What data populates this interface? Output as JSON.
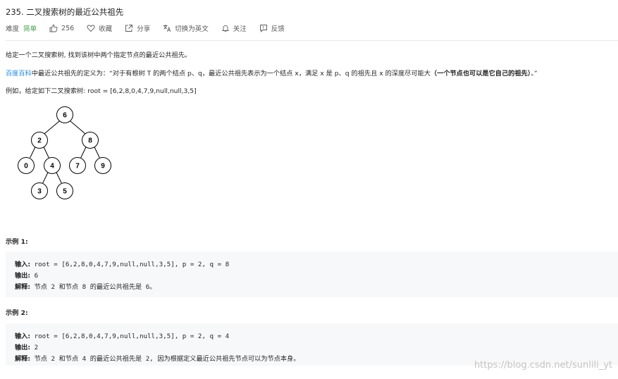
{
  "problem": {
    "title": "235. 二叉搜索树的最近公共祖先",
    "difficulty_label": "难度",
    "difficulty": "简单",
    "likes": "256",
    "actions": {
      "favorite": "收藏",
      "share": "分享",
      "switch_lang": "切换为英文",
      "follow": "关注",
      "feedback": "反馈"
    }
  },
  "description": {
    "line1": "给定一个二叉搜索树, 找到该树中两个指定节点的最近公共祖先。",
    "baike_link": "百度百科",
    "line2_a": "中最近公共祖先的定义为：“对于有根树 T 的两个结点 p、q，最近公共祖先表示为一个结点 x，满足 x 是 p、q 的祖先且 x 的深度尽可能大",
    "line2_bold": "（一个节点也可以是它自己的祖先）",
    "line2_end": "。”",
    "line3": "例如，给定如下二叉搜索树:  root = [6,2,8,0,4,7,9,null,null,3,5]"
  },
  "tree": {
    "nodes": [
      "6",
      "2",
      "8",
      "0",
      "4",
      "7",
      "9",
      "3",
      "5"
    ],
    "colors": {
      "stroke": "#000000",
      "fill": "#ffffff"
    }
  },
  "examples": [
    {
      "heading": "示例 1:",
      "input_label": "输入:",
      "input": " root = [6,2,8,0,4,7,9,null,null,3,5], p = 2, q = 8",
      "output_label": "输出:",
      "output": " 6",
      "explain_label": "解释:",
      "explain": " 节点 2 和节点 8 的最近公共祖先是 6。"
    },
    {
      "heading": "示例 2:",
      "input_label": "输入:",
      "input": " root = [6,2,8,0,4,7,9,null,null,3,5], p = 2, q = 4",
      "output_label": "输出:",
      "output": " 2",
      "explain_label": "解释:",
      "explain": " 节点 2 和节点 4 的最近公共祖先是 2, 因为根据定义最近公共祖先节点可以为节点本身。"
    }
  ],
  "watermark": "https://blog.csdn.net/sunlili_yt"
}
